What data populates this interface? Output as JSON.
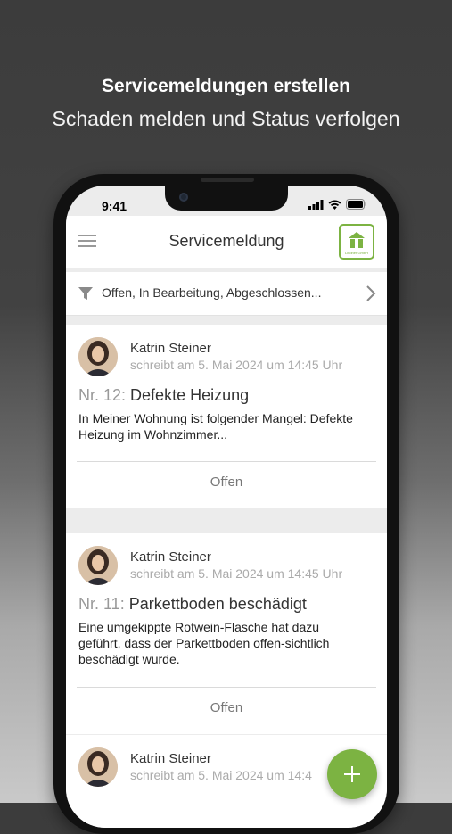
{
  "promo": {
    "title": "Servicemeldungen erstellen",
    "subtitle": "Schaden melden und Status verfolgen"
  },
  "status_bar": {
    "time": "9:41",
    "icons": [
      "signal-icon",
      "wifi-icon",
      "battery-icon"
    ]
  },
  "header": {
    "title": "Servicemeldung",
    "logo_text": "Lindner GmbH",
    "menu_icon": "hamburger-icon"
  },
  "filter": {
    "text": "Offen, In Bearbeitung, Abgeschlossen...",
    "icon": "filter-icon"
  },
  "tickets": [
    {
      "author": "Katrin Steiner",
      "meta": "schreibt am 5. Mai 2024 um 14:45 Uhr",
      "number": "Nr. 12:",
      "title": "Defekte Heizung",
      "description": "In Meiner Wohnung ist folgender Mangel: Defekte Heizung im Wohnzimmer...",
      "status": "Offen"
    },
    {
      "author": "Katrin Steiner",
      "meta": "schreibt am 5. Mai 2024 um 14:45 Uhr",
      "number": "Nr. 11:",
      "title": "Parkettboden beschädigt",
      "description": "Eine umgekippte Rotwein-Flasche hat dazu geführt, dass der Parkettboden offen-sichtlich beschädigt wurde.",
      "status": "Offen"
    },
    {
      "author": "Katrin Steiner",
      "meta": "schreibt am 5. Mai 2024 um 14:4"
    }
  ],
  "fab": {
    "icon": "plus-icon"
  },
  "colors": {
    "accent": "#7cb342",
    "background": "#ececec"
  }
}
